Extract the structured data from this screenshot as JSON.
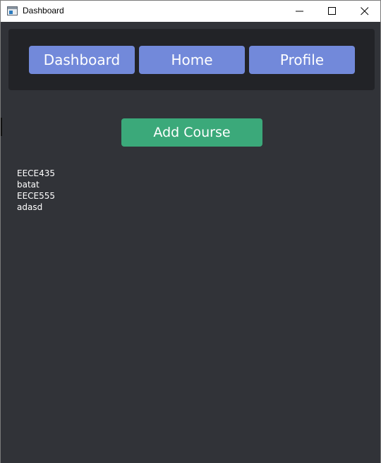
{
  "window": {
    "title": "Dashboard",
    "icon": "app-window-icon",
    "controls": [
      "minimize-icon",
      "maximize-icon",
      "close-icon"
    ]
  },
  "nav": {
    "buttons": [
      {
        "label": "Dashboard"
      },
      {
        "label": "Home"
      },
      {
        "label": "Profile"
      }
    ]
  },
  "main": {
    "add_course_label": "Add Course",
    "courses": [
      "EECE435",
      "batat",
      "EECE555",
      "adasd"
    ]
  },
  "colors": {
    "background": "#313338",
    "navbar": "#222327",
    "nav_button": "#7289da",
    "add_button": "#3ba97a",
    "text": "#ffffff"
  }
}
